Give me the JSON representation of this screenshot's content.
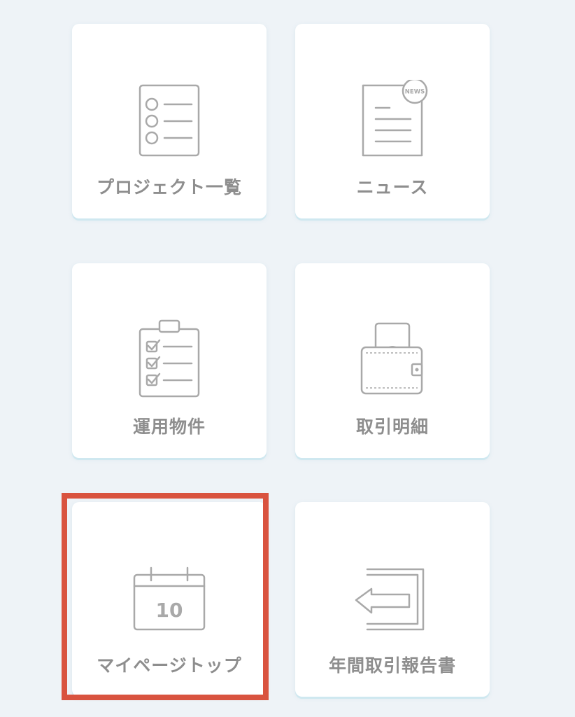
{
  "menu": {
    "items": [
      {
        "label": "プロジェクト一覧",
        "icon": "list-icon"
      },
      {
        "label": "ニュース",
        "icon": "news-document-icon",
        "badge": "NEWS"
      },
      {
        "label": "運用物件",
        "icon": "checklist-clipboard-icon"
      },
      {
        "label": "取引明細",
        "icon": "wallet-icon"
      },
      {
        "label": "マイページトップ",
        "icon": "calendar-icon",
        "calendar_day": "10",
        "highlighted": true
      },
      {
        "label": "年間取引報告書",
        "icon": "return-arrow-icon"
      }
    ]
  },
  "colors": {
    "background": "#eef3f7",
    "card": "#ffffff",
    "icon": "#a9a9a9",
    "label": "#8e8e8e",
    "highlight": "#d9533f"
  }
}
